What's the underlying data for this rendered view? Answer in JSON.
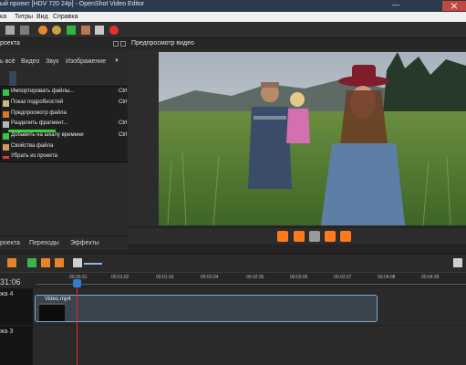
{
  "window": {
    "title": "ый проект [HDV 720 24p] - OpenShot Video Editor",
    "minimize": "—"
  },
  "menu": [
    "ка",
    "Титры",
    "Вид",
    "Справка"
  ],
  "left_panel": {
    "title": "роекта",
    "filter_tabs": [
      "ь всё",
      "Видео",
      "Звук",
      "Изображение"
    ]
  },
  "context_menu": {
    "items": [
      {
        "label": "Импортировать файлы...",
        "shortcut": "Ctrl+F",
        "icon": "plus-icon"
      },
      {
        "label": "Показ подробностей",
        "shortcut": "Ctrl+D",
        "icon": "details-icon"
      },
      {
        "label": "Предпросмотр файла",
        "shortcut": "",
        "icon": "preview-icon"
      },
      {
        "label": "Разделить фрагмент...",
        "shortcut": "Ctrl+X",
        "icon": "split-icon"
      },
      {
        "label": "Добавить на шкалу времени",
        "shortcut": "Ctrl+W",
        "icon": "plus-icon"
      },
      {
        "label": "Свойства файла",
        "shortcut": "",
        "icon": "properties-icon"
      },
      {
        "label": "Убрать из проекта",
        "shortcut": "",
        "icon": "remove-icon"
      }
    ]
  },
  "preview": {
    "title": "Предпросмотр видео"
  },
  "bottom_tabs": [
    "роекта",
    "Переходы",
    "Эффекты"
  ],
  "timeline": {
    "time_readout": "31:06",
    "ticks": [
      "00:00:31",
      "00:01:02",
      "00:01:33",
      "00:02:04",
      "00:02:35",
      "00:03:06",
      "00:03:37",
      "00:04:08",
      "00:04:39"
    ],
    "tracks": [
      {
        "label": "жа 4"
      },
      {
        "label": "жа 3"
      }
    ],
    "clip": {
      "name": "Video.mp4"
    }
  },
  "colors": {
    "accent": "#ff7a1a",
    "playhead": "#e12b2b",
    "highlight": "#33d13e"
  }
}
